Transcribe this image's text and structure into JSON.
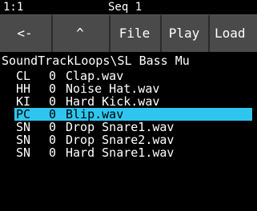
{
  "status": {
    "left": "1:1",
    "center": "Seq 1"
  },
  "toolbar": {
    "back_label": "<-",
    "up_label": "^",
    "file_label": "File",
    "play_label": "Play",
    "load_label": "Load"
  },
  "path": "SoundTrackLoops\\SL Bass Mu",
  "files": [
    {
      "tag": "CL",
      "num": "0",
      "name": "Clap.wav"
    },
    {
      "tag": "HH",
      "num": "0",
      "name": "Noise Hat.wav"
    },
    {
      "tag": "KI",
      "num": "0",
      "name": "Hard Kick.wav"
    },
    {
      "tag": "PC",
      "num": "0",
      "name": "Blip.wav"
    },
    {
      "tag": "SN",
      "num": "0",
      "name": "Drop Snare1.wav"
    },
    {
      "tag": "SN",
      "num": "0",
      "name": "Drop Snare2.wav"
    },
    {
      "tag": "SN",
      "num": "0",
      "name": "Hard Snare1.wav"
    }
  ],
  "selected_index": 3,
  "colors": {
    "selection": "#2ec6ef",
    "toolbar": "#4a4a4a",
    "background": "#000000"
  }
}
